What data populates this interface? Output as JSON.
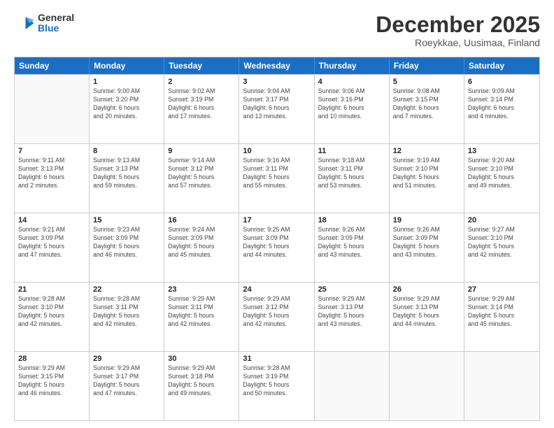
{
  "header": {
    "logo_general": "General",
    "logo_blue": "Blue",
    "title": "December 2025",
    "location": "Roeykkae, Uusimaa, Finland"
  },
  "calendar": {
    "weekdays": [
      "Sunday",
      "Monday",
      "Tuesday",
      "Wednesday",
      "Thursday",
      "Friday",
      "Saturday"
    ],
    "rows": [
      [
        {
          "day": "",
          "info": ""
        },
        {
          "day": "1",
          "info": "Sunrise: 9:00 AM\nSunset: 3:20 PM\nDaylight: 6 hours\nand 20 minutes."
        },
        {
          "day": "2",
          "info": "Sunrise: 9:02 AM\nSunset: 3:19 PM\nDaylight: 6 hours\nand 17 minutes."
        },
        {
          "day": "3",
          "info": "Sunrise: 9:04 AM\nSunset: 3:17 PM\nDaylight: 6 hours\nand 13 minutes."
        },
        {
          "day": "4",
          "info": "Sunrise: 9:06 AM\nSunset: 3:16 PM\nDaylight: 6 hours\nand 10 minutes."
        },
        {
          "day": "5",
          "info": "Sunrise: 9:08 AM\nSunset: 3:15 PM\nDaylight: 6 hours\nand 7 minutes."
        },
        {
          "day": "6",
          "info": "Sunrise: 9:09 AM\nSunset: 3:14 PM\nDaylight: 6 hours\nand 4 minutes."
        }
      ],
      [
        {
          "day": "7",
          "info": "Sunrise: 9:11 AM\nSunset: 3:13 PM\nDaylight: 6 hours\nand 2 minutes."
        },
        {
          "day": "8",
          "info": "Sunrise: 9:13 AM\nSunset: 3:13 PM\nDaylight: 5 hours\nand 59 minutes."
        },
        {
          "day": "9",
          "info": "Sunrise: 9:14 AM\nSunset: 3:12 PM\nDaylight: 5 hours\nand 57 minutes."
        },
        {
          "day": "10",
          "info": "Sunrise: 9:16 AM\nSunset: 3:11 PM\nDaylight: 5 hours\nand 55 minutes."
        },
        {
          "day": "11",
          "info": "Sunrise: 9:18 AM\nSunset: 3:11 PM\nDaylight: 5 hours\nand 53 minutes."
        },
        {
          "day": "12",
          "info": "Sunrise: 9:19 AM\nSunset: 3:10 PM\nDaylight: 5 hours\nand 51 minutes."
        },
        {
          "day": "13",
          "info": "Sunrise: 9:20 AM\nSunset: 3:10 PM\nDaylight: 5 hours\nand 49 minutes."
        }
      ],
      [
        {
          "day": "14",
          "info": "Sunrise: 9:21 AM\nSunset: 3:09 PM\nDaylight: 5 hours\nand 47 minutes."
        },
        {
          "day": "15",
          "info": "Sunrise: 9:23 AM\nSunset: 3:09 PM\nDaylight: 5 hours\nand 46 minutes."
        },
        {
          "day": "16",
          "info": "Sunrise: 9:24 AM\nSunset: 3:09 PM\nDaylight: 5 hours\nand 45 minutes."
        },
        {
          "day": "17",
          "info": "Sunrise: 9:25 AM\nSunset: 3:09 PM\nDaylight: 5 hours\nand 44 minutes."
        },
        {
          "day": "18",
          "info": "Sunrise: 9:26 AM\nSunset: 3:09 PM\nDaylight: 5 hours\nand 43 minutes."
        },
        {
          "day": "19",
          "info": "Sunrise: 9:26 AM\nSunset: 3:09 PM\nDaylight: 5 hours\nand 43 minutes."
        },
        {
          "day": "20",
          "info": "Sunrise: 9:27 AM\nSunset: 3:10 PM\nDaylight: 5 hours\nand 42 minutes."
        }
      ],
      [
        {
          "day": "21",
          "info": "Sunrise: 9:28 AM\nSunset: 3:10 PM\nDaylight: 5 hours\nand 42 minutes."
        },
        {
          "day": "22",
          "info": "Sunrise: 9:28 AM\nSunset: 3:11 PM\nDaylight: 5 hours\nand 42 minutes."
        },
        {
          "day": "23",
          "info": "Sunrise: 9:29 AM\nSunset: 3:11 PM\nDaylight: 5 hours\nand 42 minutes."
        },
        {
          "day": "24",
          "info": "Sunrise: 9:29 AM\nSunset: 3:12 PM\nDaylight: 5 hours\nand 42 minutes."
        },
        {
          "day": "25",
          "info": "Sunrise: 9:29 AM\nSunset: 3:13 PM\nDaylight: 5 hours\nand 43 minutes."
        },
        {
          "day": "26",
          "info": "Sunrise: 9:29 AM\nSunset: 3:13 PM\nDaylight: 5 hours\nand 44 minutes."
        },
        {
          "day": "27",
          "info": "Sunrise: 9:29 AM\nSunset: 3:14 PM\nDaylight: 5 hours\nand 45 minutes."
        }
      ],
      [
        {
          "day": "28",
          "info": "Sunrise: 9:29 AM\nSunset: 3:15 PM\nDaylight: 5 hours\nand 46 minutes."
        },
        {
          "day": "29",
          "info": "Sunrise: 9:29 AM\nSunset: 3:17 PM\nDaylight: 5 hours\nand 47 minutes."
        },
        {
          "day": "30",
          "info": "Sunrise: 9:29 AM\nSunset: 3:18 PM\nDaylight: 5 hours\nand 49 minutes."
        },
        {
          "day": "31",
          "info": "Sunrise: 9:28 AM\nSunset: 3:19 PM\nDaylight: 5 hours\nand 50 minutes."
        },
        {
          "day": "",
          "info": ""
        },
        {
          "day": "",
          "info": ""
        },
        {
          "day": "",
          "info": ""
        }
      ]
    ]
  }
}
